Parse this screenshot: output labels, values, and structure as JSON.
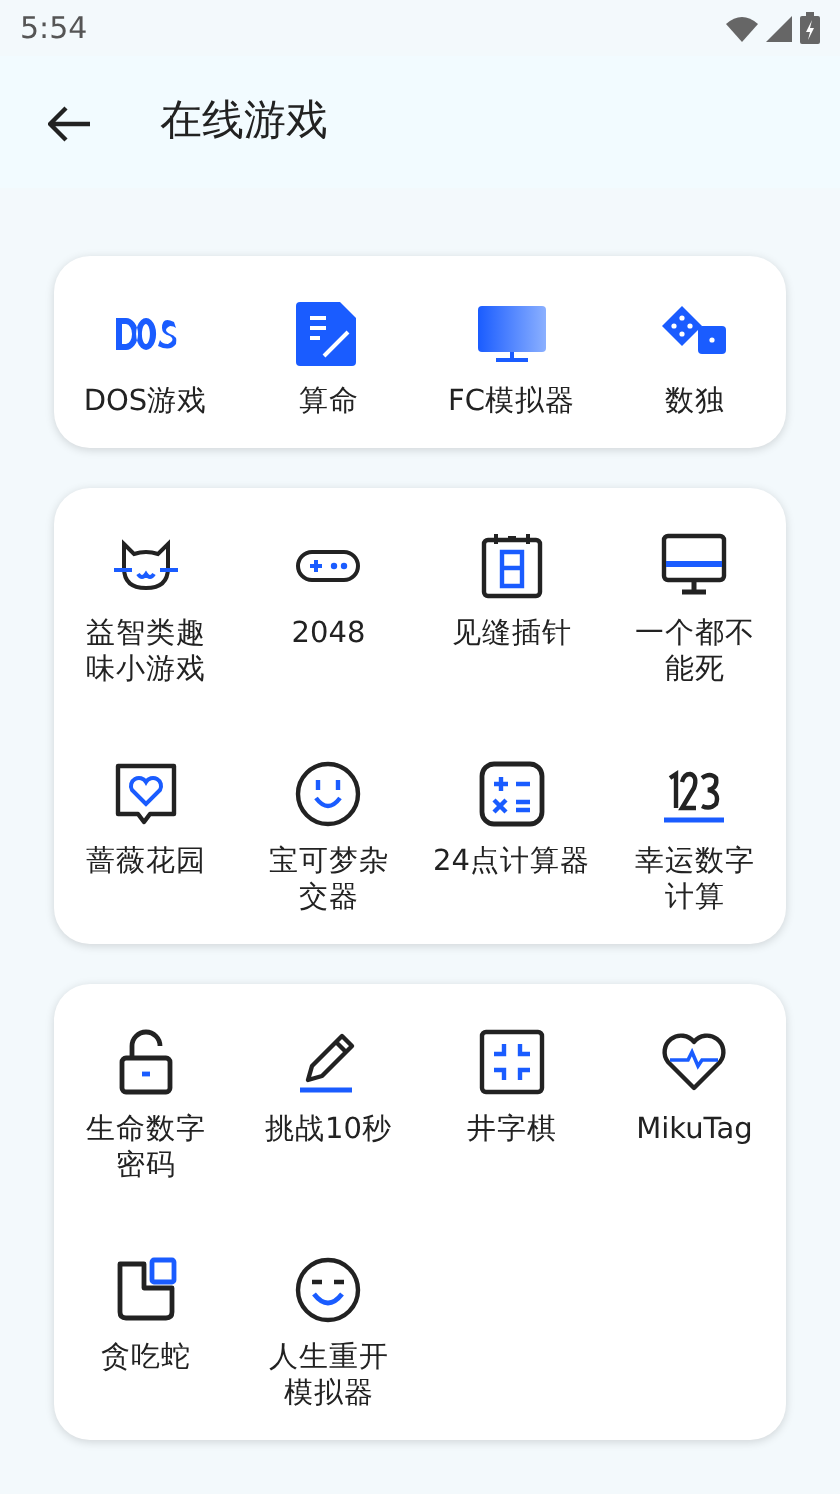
{
  "status_bar": {
    "time": "5:54"
  },
  "app_bar": {
    "title": "在线游戏"
  },
  "sections": [
    {
      "items": [
        {
          "label": "DOS游戏"
        },
        {
          "label": "算命"
        },
        {
          "label": "FC模拟器"
        },
        {
          "label": "数独"
        }
      ]
    },
    {
      "items": [
        {
          "label": "益智类趣味小游戏"
        },
        {
          "label": "2048"
        },
        {
          "label": "见缝插针"
        },
        {
          "label": "一个都不能死"
        },
        {
          "label": "蔷薇花园"
        },
        {
          "label": "宝可梦杂交器"
        },
        {
          "label": "24点计算器"
        },
        {
          "label": "幸运数字计算"
        }
      ]
    },
    {
      "items": [
        {
          "label": "生命数字密码"
        },
        {
          "label": "挑战10秒"
        },
        {
          "label": "井字棋"
        },
        {
          "label": "MikuTag"
        },
        {
          "label": "贪吃蛇"
        },
        {
          "label": "人生重开模拟器"
        }
      ]
    }
  ]
}
